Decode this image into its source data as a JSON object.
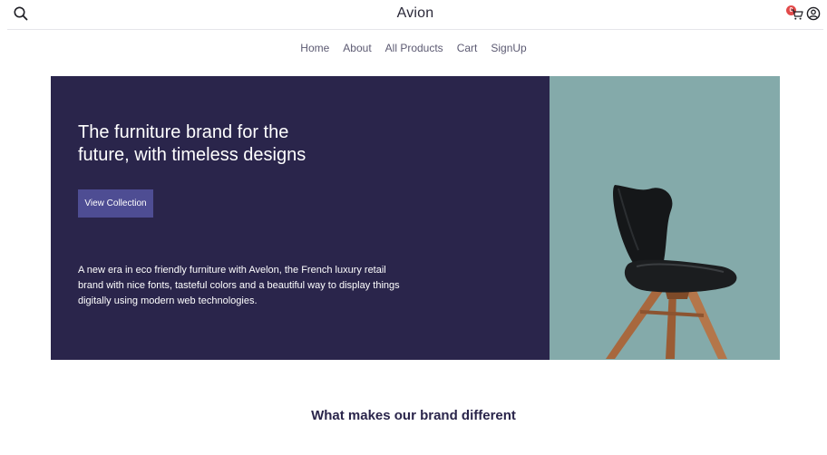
{
  "header": {
    "brand": "Avion",
    "cart_count": "0",
    "icons": [
      "search-icon",
      "cart-icon",
      "user-icon"
    ]
  },
  "nav": {
    "items": [
      "Home",
      "About",
      "All Products",
      "Cart",
      "SignUp"
    ]
  },
  "hero": {
    "title": "The furniture brand for the future, with timeless designs",
    "cta_label": "View Collection",
    "description": "A new era in eco friendly furniture with Avelon, the French luxury retail brand with nice fonts, tasteful colors and a beautiful way to display things digitally using modern web technologies.",
    "colors": {
      "panel": "#2a254b",
      "button": "#4e4d93",
      "image_bg": "#84aaaa",
      "badge": "#e24a4a"
    }
  },
  "features": {
    "title": "What makes our brand different"
  }
}
